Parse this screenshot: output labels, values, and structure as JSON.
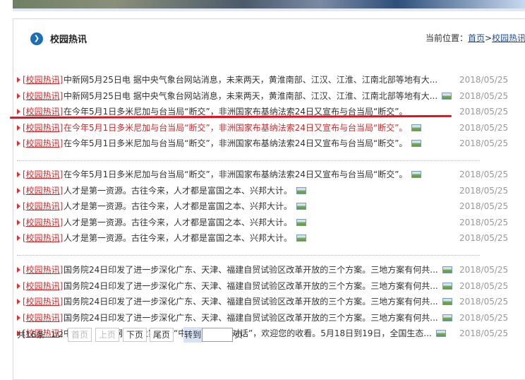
{
  "header": {
    "title": "校园热讯",
    "breadcrumb_label": "当前位置：",
    "breadcrumb_home": "首页",
    "breadcrumb_sep": ">",
    "breadcrumb_current": "校园热讯"
  },
  "groups": [
    [
      {
        "tag": "[校园热讯]",
        "text": "中新网5月25日电 据中央气象台网站消息，未来两天，黄淮南部、江汉、江淮、江南北部等地有大...",
        "date": "2018/05/25",
        "pic": false
      },
      {
        "tag": "[校园热讯]",
        "text": "中新网5月25日电 据中央气象台网站消息，未来两天，黄淮南部、江汉、江淮、江南北部等地有大...",
        "date": "2018/05/25",
        "pic": true
      },
      {
        "tag": "[校园热讯]",
        "text": "在今年5月1日多米尼加与台当局“断交”，非洲国家布基纳法索24日又宣布与台当局“断交”。",
        "date": "2018/05/25",
        "pic": false
      },
      {
        "tag": "[校园热讯]",
        "text": "在今年5月1日多米尼加与台当局“断交”，非洲国家布基纳法索24日又宣布与台当局“断交”。",
        "date": "2018/05/25",
        "pic": true
      },
      {
        "tag": "[校园热讯]",
        "text": "在今年5月1日多米尼加与台当局“断交”，非洲国家布基纳法索24日又宣布与台当局“断交”。",
        "date": "2018/05/25",
        "pic": true
      }
    ],
    [
      {
        "tag": "[校园热讯]",
        "text": "在今年5月1日多米尼加与台当局“断交”，非洲国家布基纳法索24日又宣布与台当局“断交”。",
        "date": "2018/05/25",
        "pic": true
      },
      {
        "tag": "[校园热讯]",
        "text": "人才是第一资源。古往今来，人才都是富国之本、兴邦大计。",
        "date": "2018/05/25",
        "pic": true
      },
      {
        "tag": "[校园热讯]",
        "text": "人才是第一资源。古往今来，人才都是富国之本、兴邦大计。",
        "date": "2018/05/25",
        "pic": true
      },
      {
        "tag": "[校园热讯]",
        "text": "人才是第一资源。古往今来，人才都是富国之本、兴邦大计。",
        "date": "2018/05/25",
        "pic": true
      },
      {
        "tag": "[校园热讯]",
        "text": "人才是第一资源。古往今来，人才都是富国之本、兴邦大计。",
        "date": "2018/05/25",
        "pic": true
      }
    ],
    [
      {
        "tag": "[校园热讯]",
        "text": "国务院24日印发了进一步深化广东、天津、福建自贸试验区改革开放的三个方案。三地方案有何共...",
        "date": "2018/05/25",
        "pic": true
      },
      {
        "tag": "[校园热讯]",
        "text": "国务院24日印发了进一步深化广东、天津、福建自贸试验区改革开放的三个方案。三地方案有何共...",
        "date": "2018/05/25",
        "pic": true
      },
      {
        "tag": "[校园热讯]",
        "text": "国务院24日印发了进一步深化广东、天津、福建自贸试验区改革开放的三个方案。三地方案有何共...",
        "date": "2018/05/25",
        "pic": true
      },
      {
        "tag": "[校园热讯]",
        "text": "国务院24日印发了进一步深化广东、天津、福建自贸试验区改革开放的三个方案。三地方案有何共...",
        "date": "2018/05/25",
        "pic": true
      },
      {
        "tag": "[校园热讯]",
        "text": "中国网：各位网友，大家好，“中国访谈 世界对话”，欢迎您的收看。5月18日到19日，全国生态...",
        "date": "2018/05/25",
        "pic": true
      }
    ]
  ],
  "pager": {
    "total": "共16条",
    "page": "1/2",
    "first": "首页",
    "prev": "上页",
    "next": "下页",
    "last": "尾页",
    "goto": "转到",
    "goto_value": "",
    "unit": "页"
  }
}
